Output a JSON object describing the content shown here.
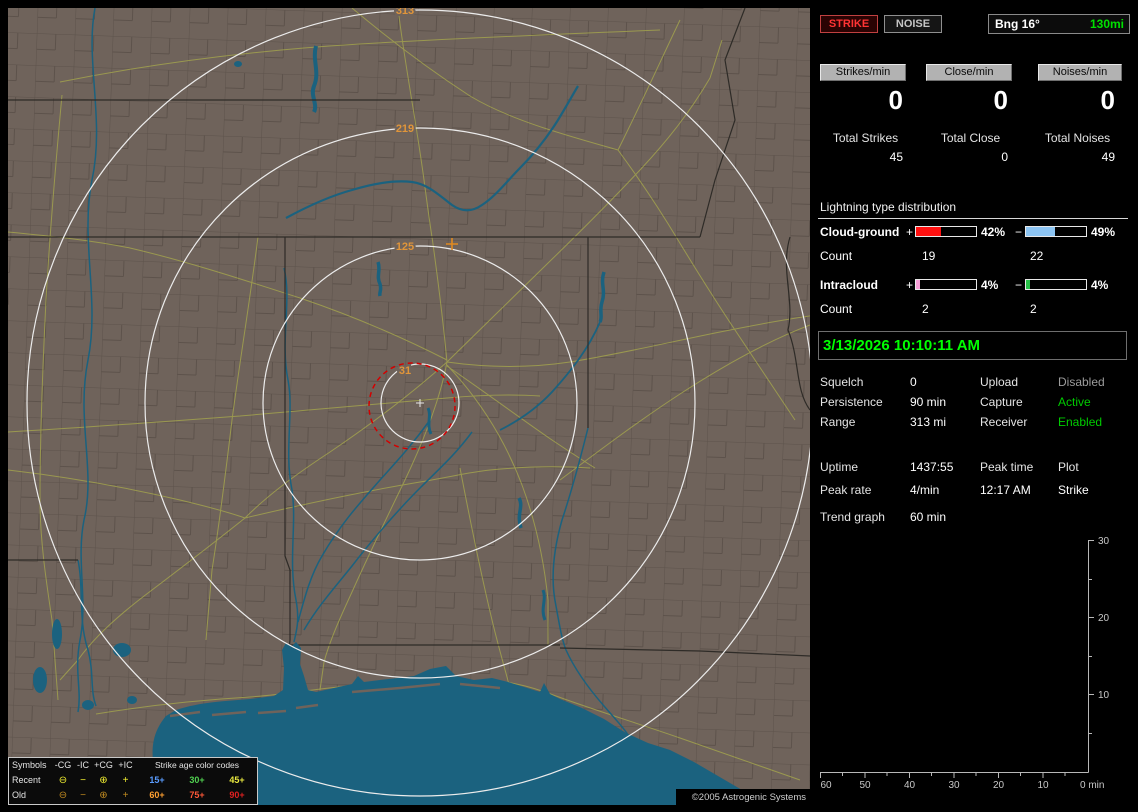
{
  "app": {
    "copyright": "©2005 Astrogenic Systems"
  },
  "map": {
    "ring_labels": [
      "313",
      "219",
      "125",
      "31"
    ],
    "colors": {
      "land": "#6f635b",
      "water": "#1b627f",
      "road": "#a2a24e",
      "ring": "#ececec",
      "ring_label": "#e0953a",
      "alert_circle": "#d40000",
      "strike_marker": "#e08a20"
    },
    "legend": {
      "symbols_title": "Symbols",
      "columns": [
        "-CG",
        "-IC",
        "+CG",
        "+IC"
      ],
      "age_title": "Strike age color codes",
      "symbols": {
        "cg_neg": "⊖",
        "ic_neg": "−",
        "cg_pos": "⊕",
        "ic_pos": "+"
      },
      "rows": [
        {
          "label": "Recent",
          "sym_color": "#f0ee30",
          "ages": [
            {
              "text": "15+",
              "color": "#5a9cff"
            },
            {
              "text": "30+",
              "color": "#50d050"
            },
            {
              "text": "45+",
              "color": "#eaea40"
            }
          ]
        },
        {
          "label": "Old",
          "sym_color": "#c08a20",
          "ages": [
            {
              "text": "60+",
              "color": "#ffa030"
            },
            {
              "text": "75+",
              "color": "#ff5838"
            },
            {
              "text": "90+",
              "color": "#e02020"
            }
          ]
        }
      ]
    }
  },
  "sidebar": {
    "mode_buttons": [
      {
        "label": "STRIKE",
        "active": true
      },
      {
        "label": "NOISE",
        "active": false
      }
    ],
    "bearing": {
      "label": "Bng 16°",
      "range": "130mi"
    },
    "rates": [
      {
        "label": "Strikes/min",
        "value": "0"
      },
      {
        "label": "Close/min",
        "value": "0"
      },
      {
        "label": "Noises/min",
        "value": "0"
      }
    ],
    "totals": [
      {
        "label": "Total Strikes",
        "value": "45"
      },
      {
        "label": "Total Close",
        "value": "0"
      },
      {
        "label": "Total Noises",
        "value": "49"
      }
    ],
    "distribution": {
      "title": "Lightning type distribution",
      "count_label": "Count",
      "plus": "+",
      "minus": "−",
      "rows": [
        {
          "label": "Cloud-ground",
          "pos_pct": "42%",
          "neg_pct": "49%",
          "pos_count": "19",
          "neg_count": "22",
          "pos_fill": 42,
          "neg_fill": 49,
          "pos_color": "#ff1010",
          "neg_color": "#8cc4f2"
        },
        {
          "label": "Intracloud",
          "pos_pct": "4%",
          "neg_pct": "4%",
          "pos_count": "2",
          "neg_count": "2",
          "pos_fill": 6,
          "neg_fill": 6,
          "pos_color": "#f8a0d8",
          "neg_color": "#28c048"
        }
      ]
    },
    "clock": "3/13/2026 10:10:11 AM",
    "settings": [
      {
        "label": "Squelch",
        "value": "0",
        "color": "#ffffff"
      },
      {
        "label": "Persistence",
        "value": "90 min",
        "color": "#ffffff"
      },
      {
        "label": "Range",
        "value": "313 mi",
        "color": "#ffffff"
      }
    ],
    "statuses": [
      {
        "label": "Upload",
        "value": "Disabled",
        "color": "#9c9c9c"
      },
      {
        "label": "Capture",
        "value": "Active",
        "color": "#00cc00"
      },
      {
        "label": "Receiver",
        "value": "Enabled",
        "color": "#00cc00"
      }
    ],
    "stats": {
      "uptime_label": "Uptime",
      "uptime_value": "1437:55",
      "peak_time_label": "Peak time",
      "peak_time_value": "12:17 AM",
      "plot_label": "Plot",
      "plot_value": "Strike",
      "peak_rate_label": "Peak rate",
      "peak_rate_value": "4/min",
      "trend_label": "Trend graph",
      "trend_value": "60 min"
    },
    "trend_axes": {
      "y_ticks": [
        "30",
        "20",
        "10"
      ],
      "x_ticks": [
        "60",
        "50",
        "40",
        "30",
        "20",
        "10"
      ],
      "origin_label": "0 min"
    },
    "colors": {
      "clock": "#00ff00",
      "accent_green": "#00e000",
      "strike_red": "#ff3434"
    }
  }
}
